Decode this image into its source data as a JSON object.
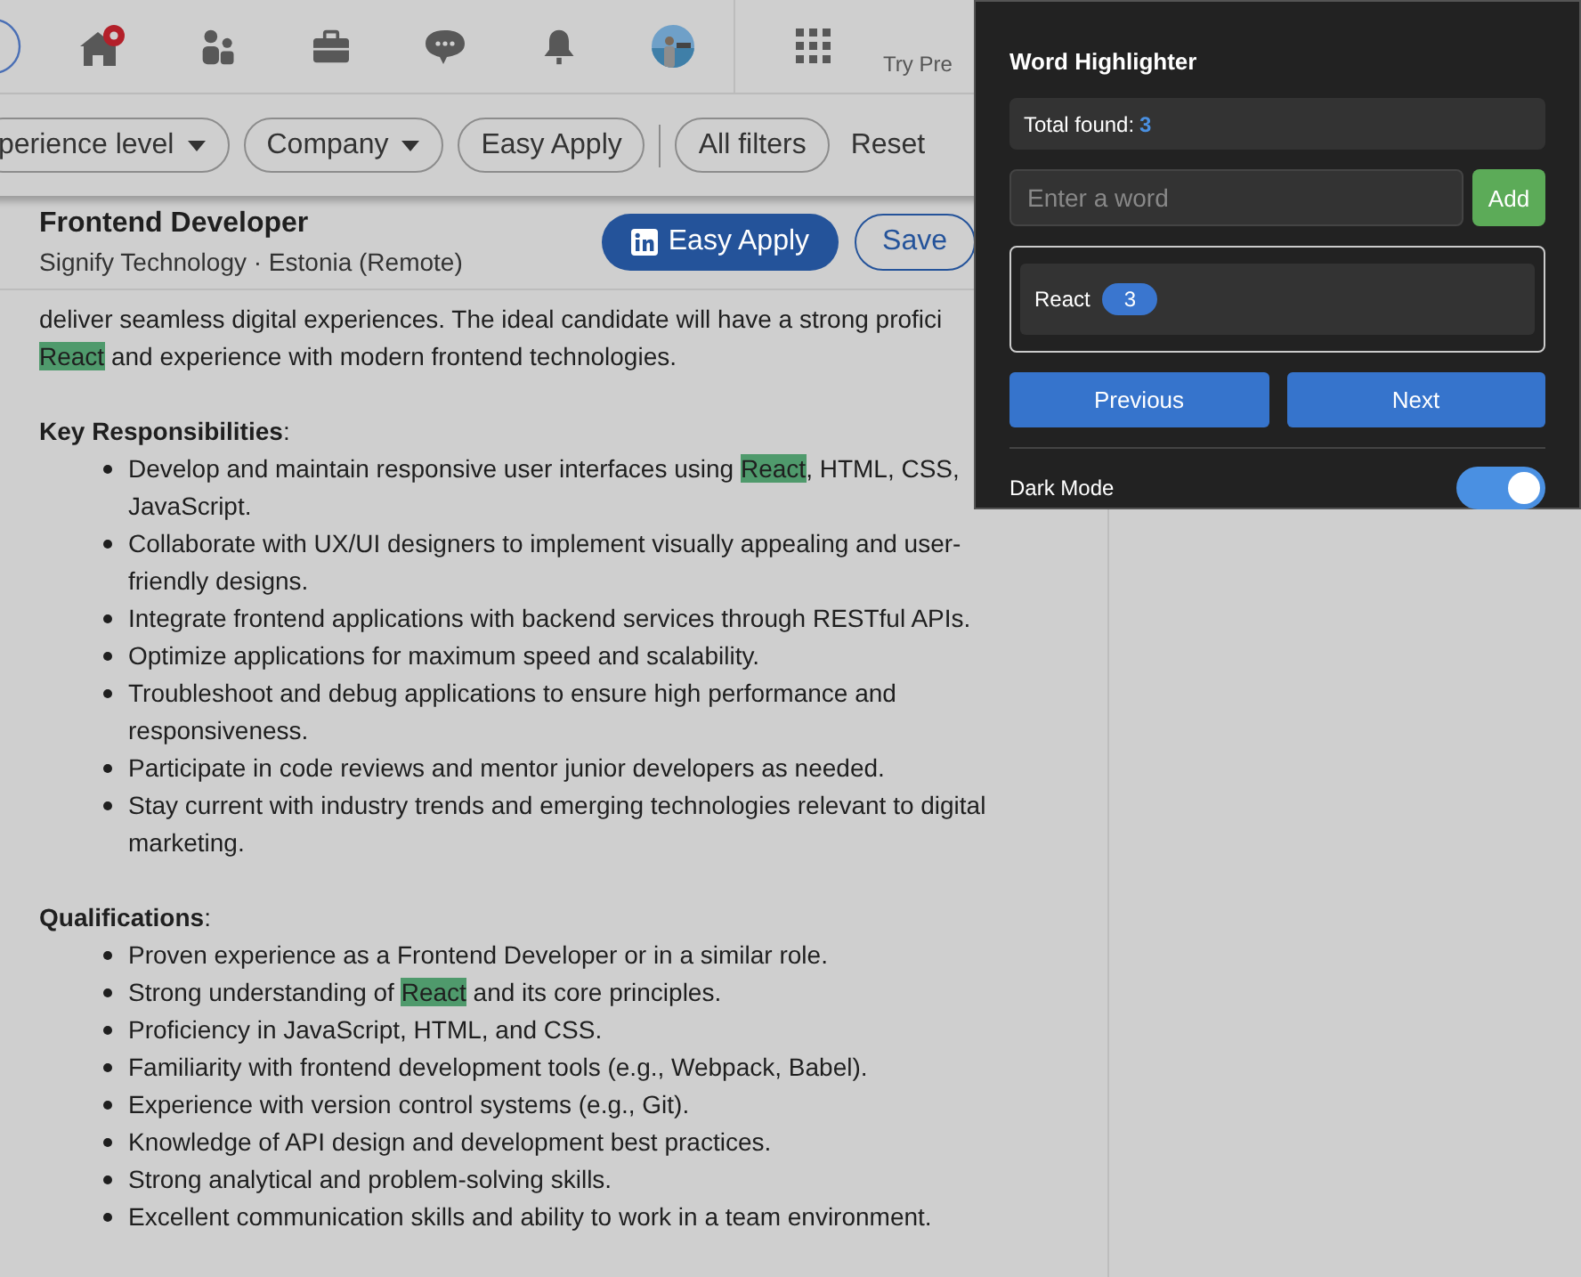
{
  "nav": {
    "premium_text": "Try Pre"
  },
  "filters": [
    {
      "label": "perience level",
      "dropdown": true
    },
    {
      "label": "Company",
      "dropdown": true
    },
    {
      "label": "Easy Apply",
      "dropdown": false
    },
    {
      "kind": "divider"
    },
    {
      "label": "All filters",
      "dropdown": false
    },
    {
      "kind": "reset",
      "label": "Reset"
    }
  ],
  "job": {
    "title": "Frontend Developer",
    "subtitle": "Signify Technology · Estonia (Remote)",
    "apply_label": "Easy Apply",
    "save_label": "Save"
  },
  "description": {
    "intro": [
      [
        {
          "text": "deliver seamless digital experiences. The ideal candidate will have a strong profici",
          "highlighted": false
        }
      ],
      [
        {
          "text": "React",
          "highlighted": true
        },
        {
          "text": " and experience with modern frontend technologies.",
          "highlighted": false
        }
      ]
    ],
    "sections": [
      {
        "heading": "**Key Responsibilities**:",
        "items": [
          [
            [
              {
                "text": "Develop and maintain responsive user interfaces using ",
                "highlighted": false
              },
              {
                "text": "React",
                "highlighted": true
              },
              {
                "text": ", HTML, CSS,",
                "highlighted": false
              }
            ],
            [
              {
                "text": "JavaScript.",
                "highlighted": false
              }
            ]
          ],
          [
            [
              {
                "text": "Collaborate with UX/UI designers to implement visually appealing and user-",
                "highlighted": false
              }
            ],
            [
              {
                "text": "friendly designs.",
                "highlighted": false
              }
            ]
          ],
          [
            [
              {
                "text": "Integrate frontend applications with backend services through RESTful APIs.",
                "highlighted": false
              }
            ]
          ],
          [
            [
              {
                "text": "Optimize applications for maximum speed and scalability.",
                "highlighted": false
              }
            ]
          ],
          [
            [
              {
                "text": "Troubleshoot and debug applications to ensure high performance and",
                "highlighted": false
              }
            ],
            [
              {
                "text": "responsiveness.",
                "highlighted": false
              }
            ]
          ],
          [
            [
              {
                "text": "Participate in code reviews and mentor junior developers as needed.",
                "highlighted": false
              }
            ]
          ],
          [
            [
              {
                "text": "Stay current with industry trends and emerging technologies relevant to digital",
                "highlighted": false
              }
            ],
            [
              {
                "text": "marketing.",
                "highlighted": false
              }
            ]
          ]
        ]
      },
      {
        "heading": "**Qualifications**:",
        "items": [
          [
            [
              {
                "text": "Proven experience as a Frontend Developer or in a similar role.",
                "highlighted": false
              }
            ]
          ],
          [
            [
              {
                "text": "Strong understanding of ",
                "highlighted": false
              },
              {
                "text": "React",
                "highlighted": true
              },
              {
                "text": " and its core principles.",
                "highlighted": false
              }
            ]
          ],
          [
            [
              {
                "text": "Proficiency in JavaScript, HTML, and CSS.",
                "highlighted": false
              }
            ]
          ],
          [
            [
              {
                "text": "Familiarity with frontend development tools (e.g., Webpack, Babel).",
                "highlighted": false
              }
            ]
          ],
          [
            [
              {
                "text": "Experience with version control systems (e.g., Git).",
                "highlighted": false
              }
            ]
          ],
          [
            [
              {
                "text": "Knowledge of API design and development best practices.",
                "highlighted": false
              }
            ]
          ],
          [
            [
              {
                "text": "Strong analytical and problem-solving skills.",
                "highlighted": false
              }
            ]
          ],
          [
            [
              {
                "text": "Excellent communication skills and ability to work in a team environment.",
                "highlighted": false
              }
            ]
          ]
        ]
      }
    ]
  },
  "popup": {
    "title": "Word Highlighter",
    "total_label": "Total found:",
    "total_value": "3",
    "input": {
      "placeholder": "Enter a word"
    },
    "add_label": "Add",
    "words": [
      {
        "word": "React",
        "count": "3"
      }
    ],
    "previous_label": "Previous",
    "next_label": "Next",
    "dark_mode": {
      "label": "Dark Mode",
      "on": true
    }
  }
}
